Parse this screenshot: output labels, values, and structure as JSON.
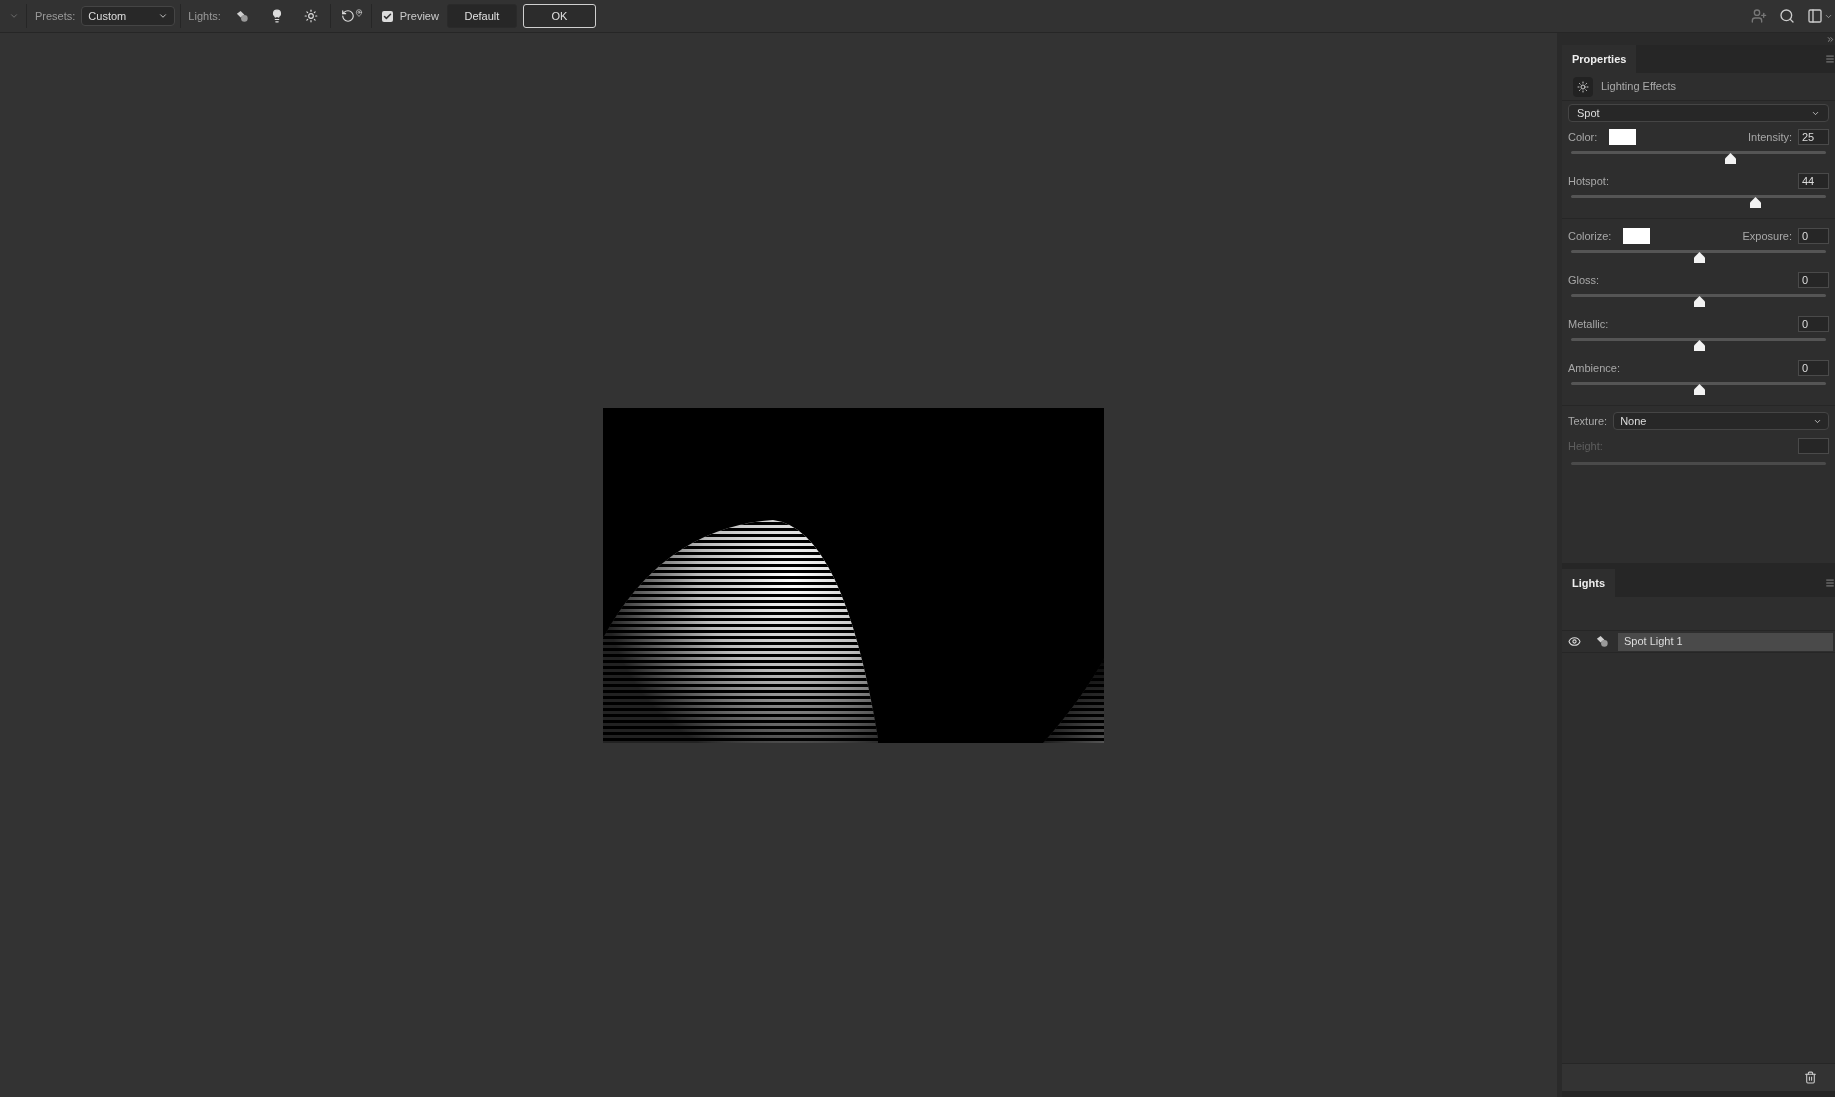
{
  "toolbar": {
    "presets_label": "Presets:",
    "preset": "Custom",
    "lights_label": "Lights:",
    "preview": {
      "label": "Preview",
      "checked": true
    },
    "buttons": [
      {
        "label": "Default",
        "kind": "plain"
      },
      {
        "label": "OK",
        "kind": "primary"
      }
    ]
  },
  "properties": {
    "title": "Properties",
    "effect": "Lighting Effects",
    "light_type": "Spot",
    "sections": [
      {
        "rows": [
          {
            "label": "Color:",
            "color": "#ffffff",
            "value_label": "Intensity:",
            "value": "25",
            "level": 0.625
          },
          {
            "label": "Hotspot:",
            "value": "44",
            "level": 0.72
          }
        ]
      },
      {
        "rows": [
          {
            "label": "Colorize:",
            "color": "#ffffff",
            "value_label": "Exposure:",
            "value": "0",
            "level": 0.5
          },
          {
            "label": "Gloss:",
            "value": "0",
            "level": 0.5
          },
          {
            "label": "Metallic:",
            "value": "0",
            "level": 0.5
          },
          {
            "label": "Ambience:",
            "value": "0",
            "level": 0.5
          }
        ]
      }
    ],
    "texture": {
      "label": "Texture:",
      "value": "None"
    },
    "height": {
      "label": "Height:",
      "disabled": true
    }
  },
  "lights": {
    "title": "Lights",
    "items": [
      {
        "name": "Spot Light 1",
        "visible": true,
        "selected": true
      }
    ]
  }
}
